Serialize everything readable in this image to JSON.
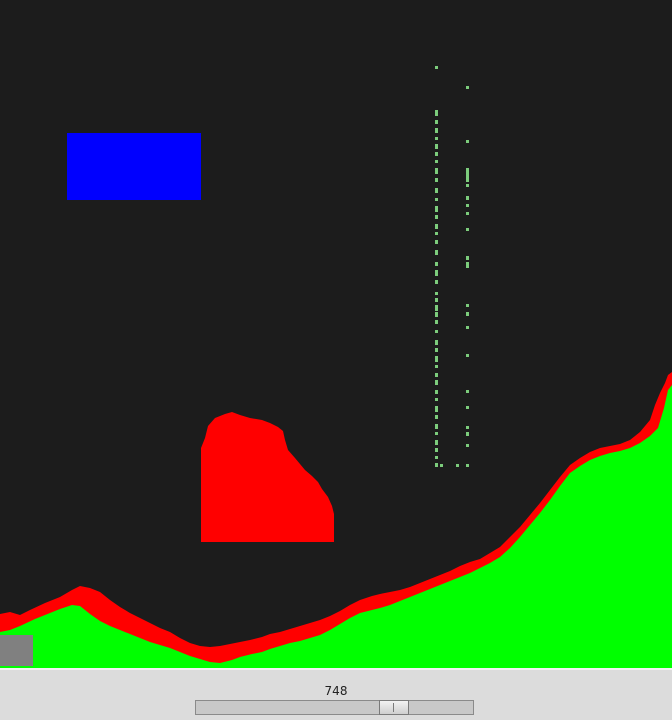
{
  "colors": {
    "background": "#1c1c1c",
    "terrain": "#00ff00",
    "terrain_edge": "#ff0000",
    "red_body": "#ff0000",
    "blue_block": "#0000ff",
    "gray_block": "#808080",
    "particles": "#7ccc7c",
    "control_bar": "#dcdcdc"
  },
  "slider": {
    "value": "748",
    "fraction": 0.74
  }
}
